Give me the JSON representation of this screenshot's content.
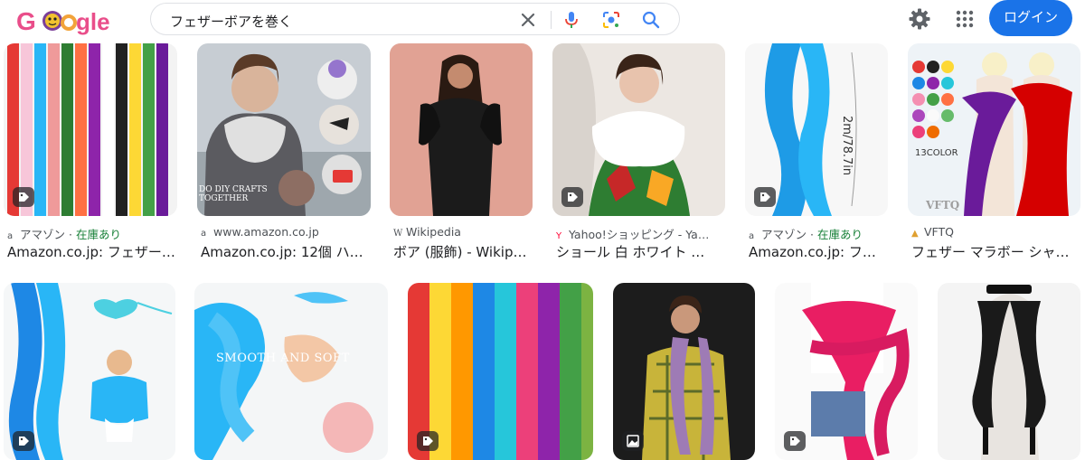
{
  "logo": {
    "text": "Google"
  },
  "search": {
    "query": "フェザーボアを巻く"
  },
  "header": {
    "login_label": "ログイン"
  },
  "results_row1": [
    {
      "source": "アマゾン",
      "stock": "在庫あり",
      "sep": " · ",
      "title": "Amazon.co.jp: フェザー…",
      "badge": "tag-icon"
    },
    {
      "source": "www.amazon.co.jp",
      "stock": "",
      "sep": "",
      "title": "Amazon.co.jp: 12個 ハ…",
      "overlay": "DO DIY CRAFTS TOGETHER"
    },
    {
      "source": "Wikipedia",
      "stock": "",
      "sep": "",
      "title": "ボア (服飾) - Wikip…"
    },
    {
      "source": "Yahoo!ショッピング - Ya…",
      "stock": "",
      "sep": "",
      "title": "ショール 白 ホワイト …",
      "badge": "tag-icon"
    },
    {
      "source": "アマゾン",
      "stock": "在庫あり",
      "sep": " · ",
      "title": "Amazon.co.jp: フ…",
      "badge": "tag-icon",
      "overlay": "2m/78.7in"
    },
    {
      "source": "VFTQ",
      "stock": "",
      "sep": "",
      "title": "フェザー マラボー シャ…",
      "overlay": "13COLOR",
      "overlay2": "VFTQ"
    }
  ],
  "results_row2": [
    {
      "badge": "tag-icon"
    },
    {
      "overlay": "SMOOTH AND SOFT"
    },
    {
      "badge": "tag-icon"
    },
    {
      "badge": "image-icon"
    },
    {
      "badge": "tag-icon"
    },
    {}
  ],
  "colors": {
    "accent": "#1a73e8",
    "stock_green": "#188038",
    "meta_gray": "#4d5156"
  }
}
